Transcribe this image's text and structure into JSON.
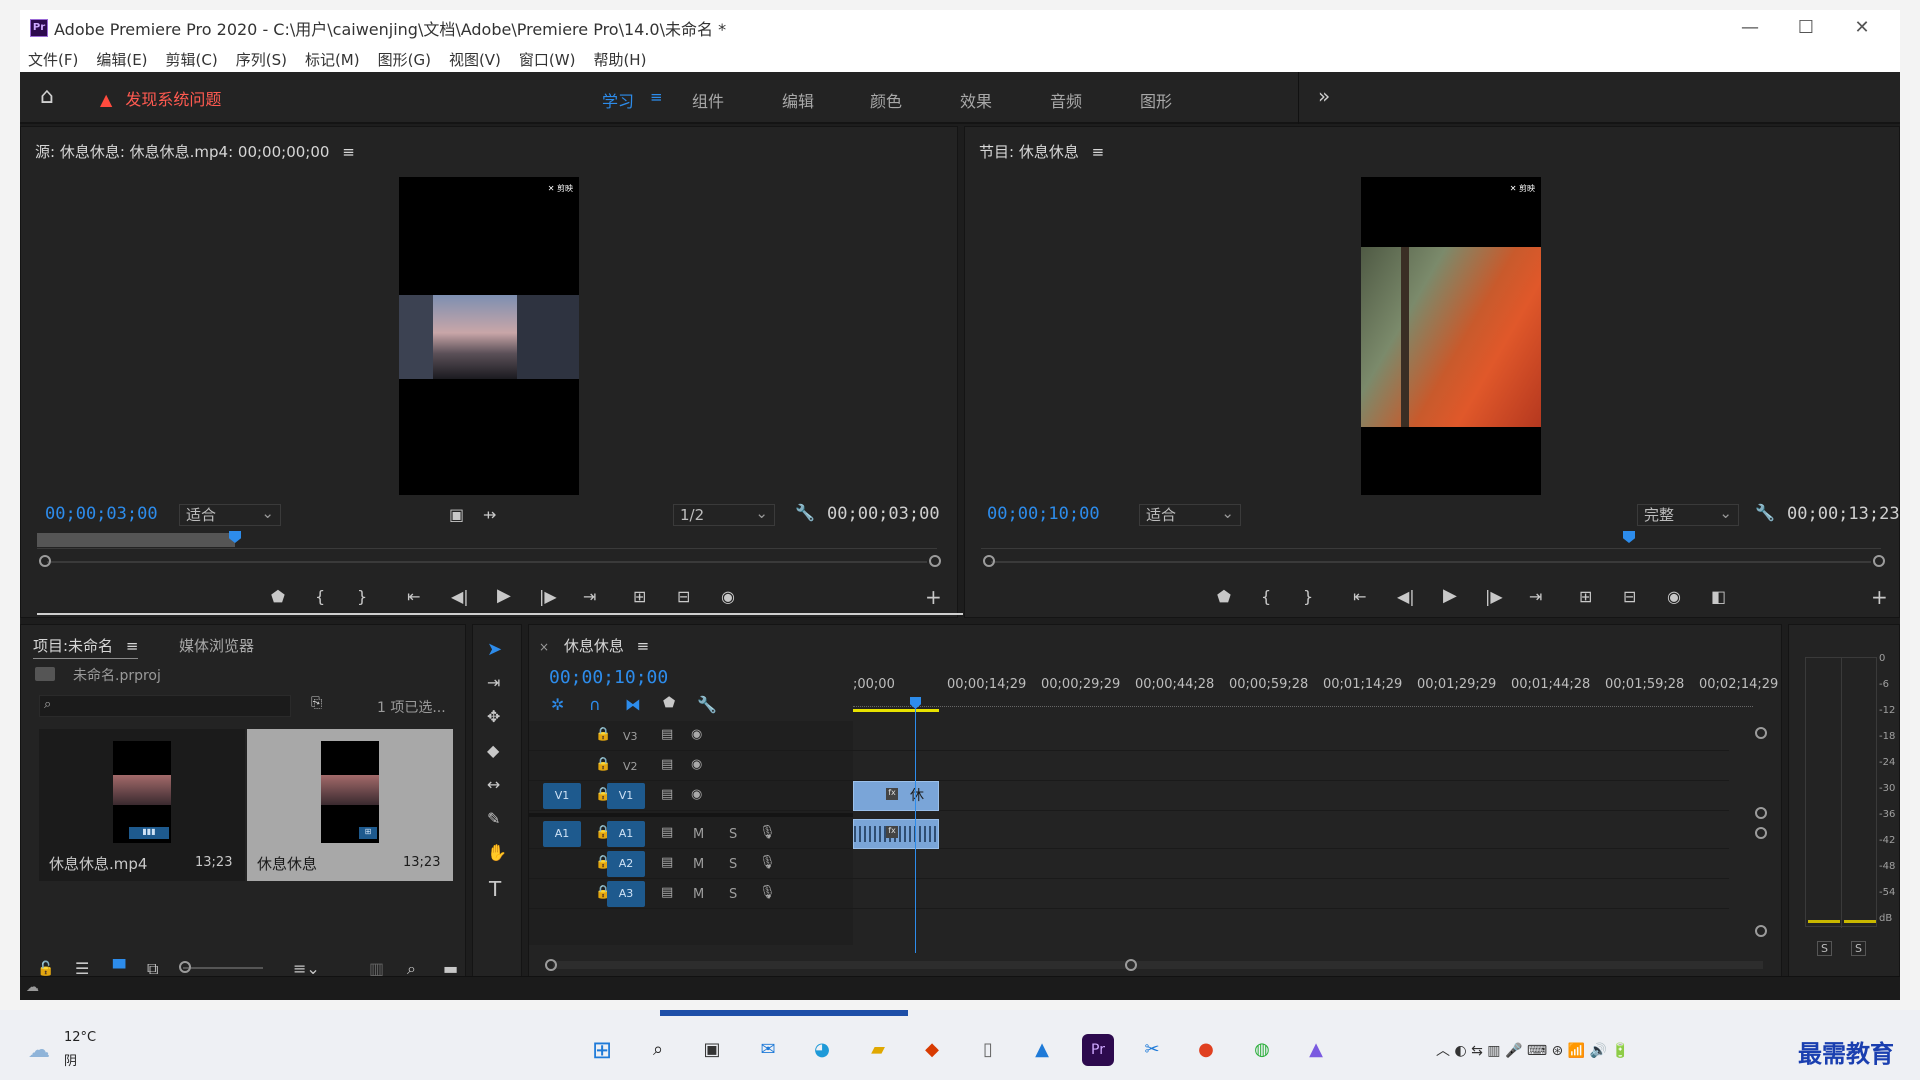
{
  "window": {
    "app_icon": "Pr",
    "title": "Adobe Premiere Pro 2020 - C:\\用户\\caiwenjing\\文档\\Adobe\\Premiere Pro\\14.0\\未命名 *",
    "minimize": "—",
    "maximize": "☐",
    "close": "✕"
  },
  "menu": [
    "文件(F)",
    "编辑(E)",
    "剪辑(C)",
    "序列(S)",
    "标记(M)",
    "图形(G)",
    "视图(V)",
    "窗口(W)",
    "帮助(H)"
  ],
  "workspace": {
    "home_icon": "home-icon",
    "warning": "发现系统问题",
    "tabs": [
      "学习",
      "组件",
      "编辑",
      "颜色",
      "效果",
      "音频",
      "图形"
    ],
    "active_tab": "学习",
    "more": "»"
  },
  "source_monitor": {
    "title": "源: 休息休息: 休息休息.mp4: 00;00;00;00",
    "timecode": "00;00;03;00",
    "fit": "适合",
    "resolution": "1/2",
    "duration": "00;00;03;00",
    "playhead_fraction": 0.22
  },
  "program_monitor": {
    "title": "节目: 休息休息",
    "timecode": "00;00;10;00",
    "fit": "适合",
    "quality": "完整",
    "duration": "00;00;13;23",
    "playhead_fraction": 0.72
  },
  "project": {
    "tab_project": "项目:未命名",
    "tab_media": "媒体浏览器",
    "file": "未命名.prproj",
    "selection_count": "1 项已选...",
    "items": [
      {
        "name": "休息休息.mp4",
        "duration": "13;23"
      },
      {
        "name": "休息休息",
        "duration": "13;23"
      }
    ]
  },
  "timeline": {
    "title": "休息休息",
    "timecode": "00;00;10;00",
    "ruler": [
      ";00;00",
      "00;00;14;29",
      "00;00;29;29",
      "00;00;44;28",
      "00;00;59;28",
      "00;01;14;29",
      "00;01;29;29",
      "00;01;44;28",
      "00;01;59;28",
      "00;02;14;29"
    ],
    "video_tracks": [
      "V3",
      "V2",
      "V1"
    ],
    "audio_tracks": [
      "A1",
      "A2",
      "A3"
    ],
    "source_patch_video": "V1",
    "source_patch_audio": "A1",
    "mute": "M",
    "solo": "S",
    "clip_label": "休"
  },
  "audio_meter": {
    "scale": [
      "0",
      "-6",
      "-12",
      "-18",
      "-24",
      "-30",
      "-36",
      "-42",
      "-48",
      "-54",
      "dB"
    ],
    "solo_left": "S",
    "solo_right": "S"
  },
  "taskbar": {
    "weather_temp": "12°C",
    "weather_desc": "阴",
    "watermark": "最需教育"
  }
}
